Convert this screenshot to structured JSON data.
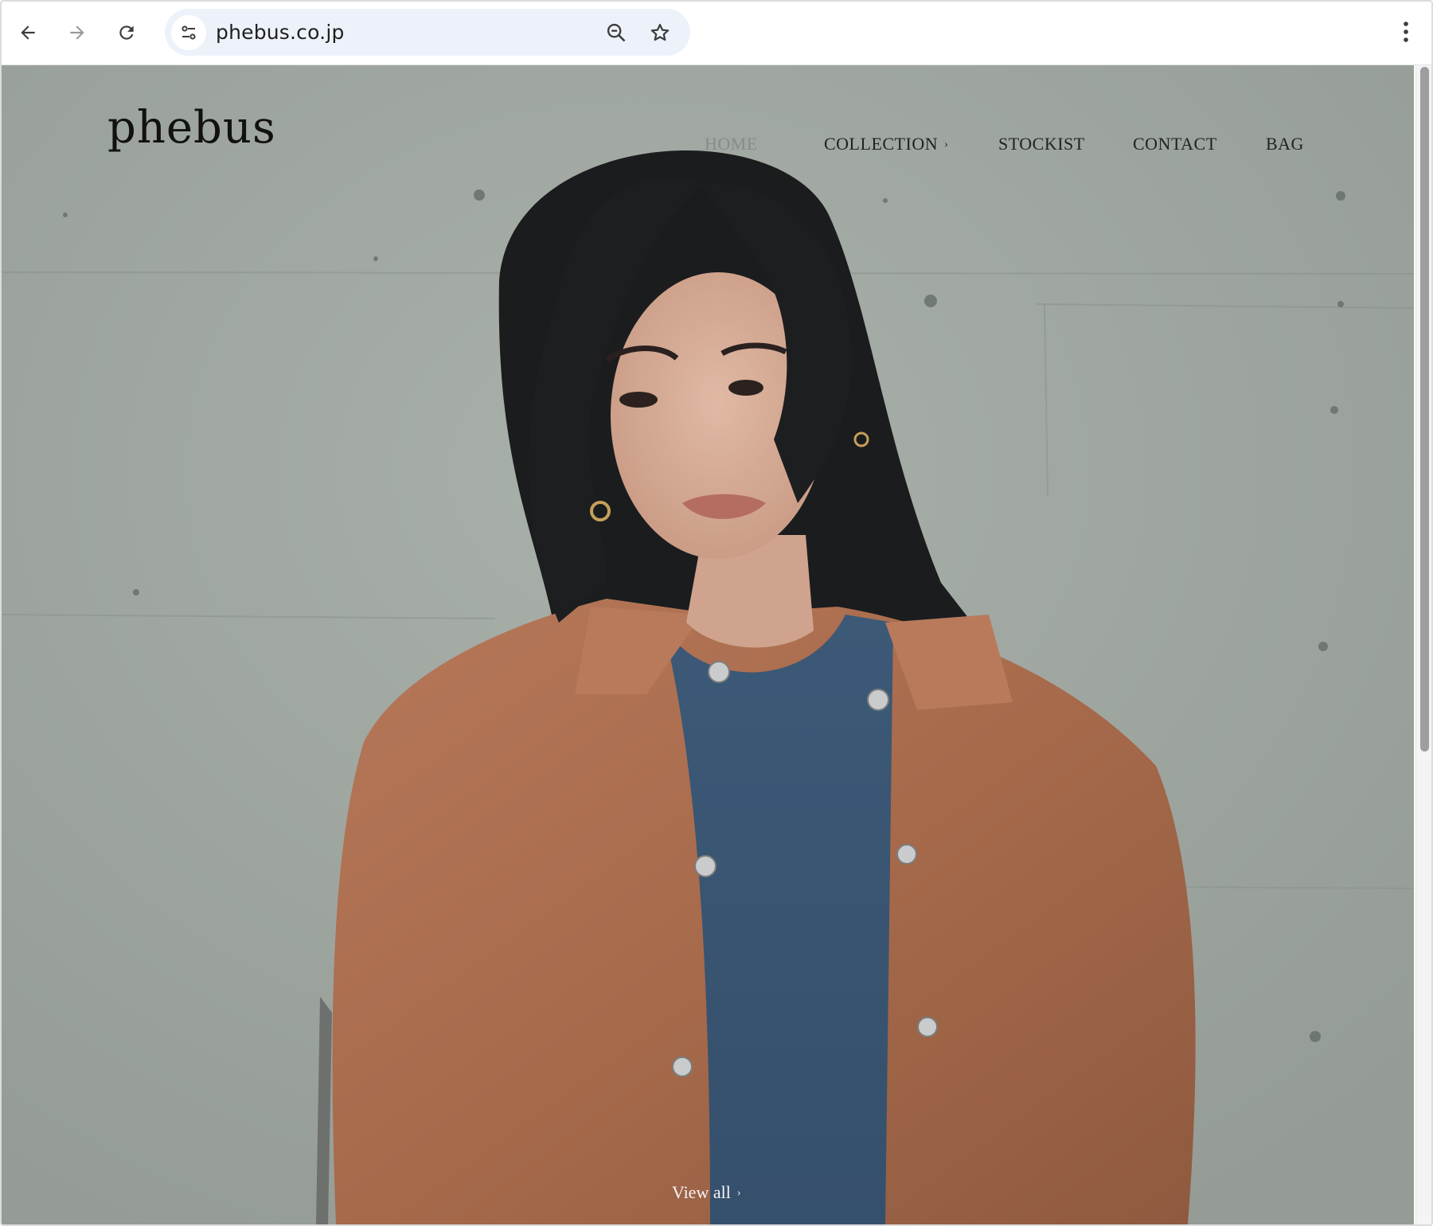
{
  "browser": {
    "url": "phebus.co.jp",
    "colors": {
      "omnibox_bg": "#edf2fa",
      "toolbar_bg": "#ffffff"
    }
  },
  "site": {
    "logo": "phebus",
    "nav": [
      {
        "label": "HOME",
        "dim": true
      },
      {
        "label": "COLLECTION",
        "has_chevron": true
      },
      {
        "label": "STOCKIST"
      },
      {
        "label": "CONTACT"
      },
      {
        "label": "BAG"
      }
    ],
    "chevron": "›",
    "view_all": "View all"
  },
  "colors": {
    "wall": "#9ea59f",
    "jacket": "#a86b4b",
    "shirt": "#3f5d7b",
    "hair": "#1b1c1e",
    "skin": "#d5ab96"
  }
}
